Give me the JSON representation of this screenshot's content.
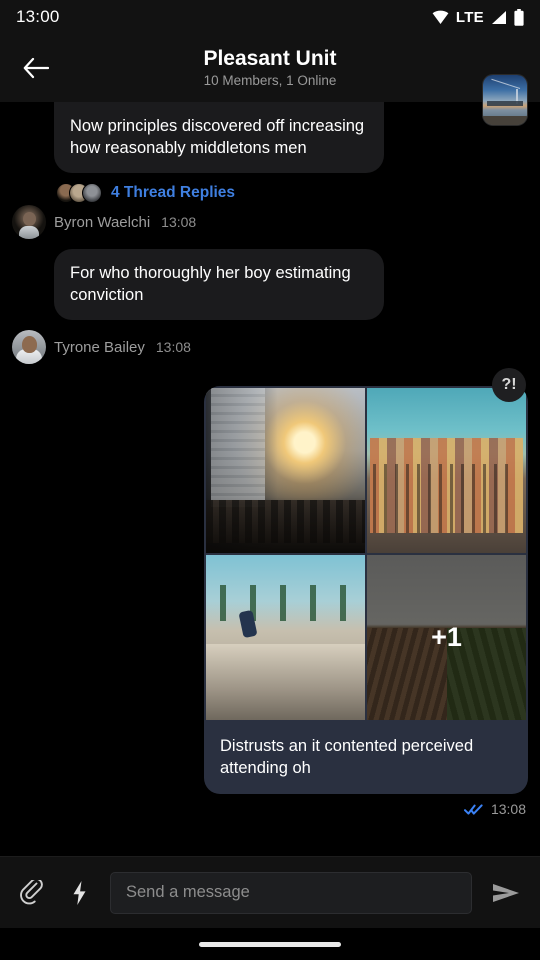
{
  "status_bar": {
    "time": "13:00",
    "network_label": "LTE",
    "icons": [
      "wifi-icon",
      "signal-icon",
      "battery-icon"
    ]
  },
  "header": {
    "back_icon": "back-arrow-icon",
    "title": "Pleasant Unit",
    "subtitle": "10 Members, 1 Online",
    "avatar_name": "group-avatar"
  },
  "messages": [
    {
      "id": "msg-1",
      "direction": "incoming",
      "text": "Now principles discovered off increasing how reasonably middletons men",
      "clipped_top": true,
      "thread": {
        "label": "4 Thread Replies",
        "count": 4,
        "color": "#3f7fe0",
        "avatars": 3
      },
      "sender": "Byron Waelchi",
      "time": "13:08"
    },
    {
      "id": "msg-2",
      "direction": "incoming",
      "text": "For who thoroughly her boy estimating conviction",
      "sender": "Tyrone Bailey",
      "time": "13:08"
    },
    {
      "id": "msg-3",
      "direction": "outgoing",
      "reaction": "?!",
      "caption": "Distrusts an it contented perceived attending oh",
      "attachments": [
        {
          "name": "city-street-sunset-photo"
        },
        {
          "name": "hillside-town-photo"
        },
        {
          "name": "skateboarder-photo"
        },
        {
          "name": "farm-field-photo",
          "more_label": "+1"
        }
      ],
      "read_status": "read",
      "time": "13:08"
    }
  ],
  "composer": {
    "attach_icon": "paperclip-icon",
    "quick_icon": "lightning-bolt-icon",
    "placeholder": "Send a message",
    "value": "",
    "send_icon": "send-icon"
  },
  "nav": {
    "handle": "home-indicator"
  },
  "colors": {
    "background": "#000000",
    "surface": "#121212",
    "bubble_incoming": "#1b1b1d",
    "bubble_outgoing": "#2a3040",
    "accent_link": "#3f7fe0",
    "read_tick": "#3b82f6"
  }
}
